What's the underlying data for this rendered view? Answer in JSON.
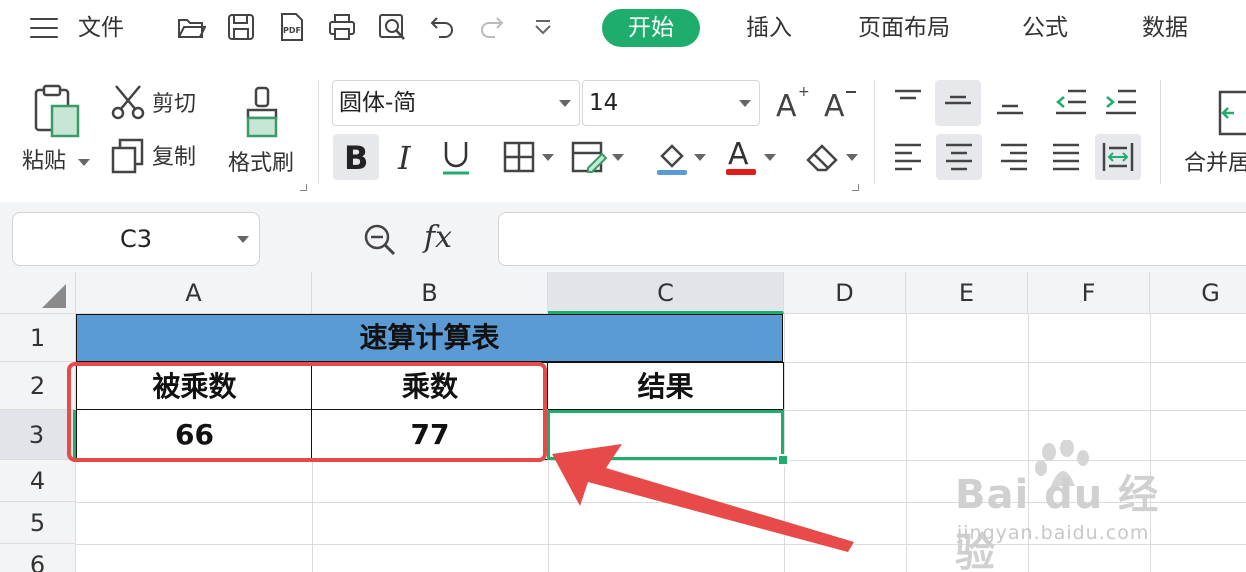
{
  "menubar": {
    "file_label": "文件",
    "tabs": [
      "开始",
      "插入",
      "页面布局",
      "公式",
      "数据"
    ]
  },
  "ribbon": {
    "paste_label": "粘贴",
    "cut_label": "剪切",
    "copy_label": "复制",
    "format_painter_label": "格式刷",
    "font_name": "圆体-简",
    "font_size": "14",
    "merge_label": "合并居"
  },
  "formula_bar": {
    "name_box": "C3",
    "fx_label": "fx",
    "formula_value": ""
  },
  "grid": {
    "columns": [
      "A",
      "B",
      "C",
      "D",
      "E",
      "F",
      "G"
    ],
    "rows": [
      "1",
      "2",
      "3",
      "4",
      "5",
      "6"
    ],
    "selected_cell": "C3",
    "title": "速算计算表",
    "headers": [
      "被乘数",
      "乘数",
      "结果"
    ],
    "values": [
      "66",
      "77",
      ""
    ]
  },
  "watermark": {
    "main": "Bai du 经验",
    "sub": "jingyan.baidu.com"
  },
  "colors": {
    "accent": "#1fad6e",
    "title_fill": "#5b9bd5",
    "annotation": "#e84a4a"
  }
}
